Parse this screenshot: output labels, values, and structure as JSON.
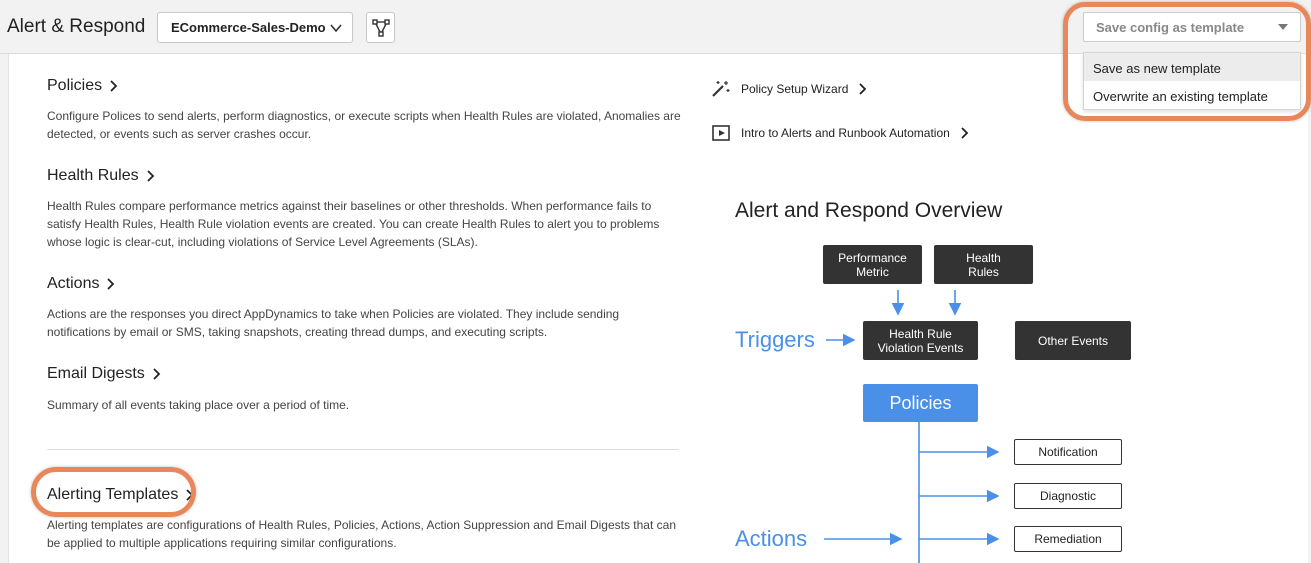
{
  "header": {
    "title": "Alert & Respond",
    "app_selector": "ECommerce-Sales-Demo",
    "template_select": {
      "placeholder": "Save config as template",
      "options": [
        "Save as new template",
        "Overwrite an existing template"
      ]
    }
  },
  "sections": [
    {
      "title": "Policies",
      "description": "Configure Polices to send alerts, perform diagnostics, or execute scripts when Health Rules are violated, Anomalies are detected, or events such as server crashes occur."
    },
    {
      "title": "Health Rules",
      "description": "Health Rules compare performance metrics against their baselines or other thresholds. When performance fails to satisfy Health Rules, Health Rule violation events are created. You can create Health Rules to alert you to problems whose logic is clear-cut, including violations of Service Level Agreements (SLAs)."
    },
    {
      "title": "Actions",
      "description": "Actions are the responses you direct AppDynamics to take when Policies are violated. They include sending notifications by email or SMS, taking snapshots, creating thread dumps, and executing scripts."
    },
    {
      "title": "Email Digests",
      "description": "Summary of all events taking place over a period of time."
    },
    {
      "title": "Alerting Templates",
      "description": "Alerting templates are configurations of Health Rules, Policies, Actions, Action Suppression and Email Digests that can be applied to multiple applications requiring similar configurations."
    }
  ],
  "quick_links": {
    "wizard": "Policy Setup Wizard",
    "intro": "Intro to Alerts and Runbook Automation"
  },
  "diagram": {
    "title": "Alert and Respond Overview",
    "performance_metric": [
      "Performance",
      "Metric"
    ],
    "health_rules": [
      "Health",
      "Rules"
    ],
    "triggers_label": "Triggers",
    "violation_events": [
      "Health Rule",
      "Violation Events"
    ],
    "other_events": "Other Events",
    "policies": "Policies",
    "actions_label": "Actions",
    "notification": "Notification",
    "diagnostic": "Diagnostic",
    "remediation": "Remediation"
  },
  "colors": {
    "accent_blue": "#4a90e8",
    "highlight_orange": "#e8875a",
    "dark_box": "#333333"
  }
}
